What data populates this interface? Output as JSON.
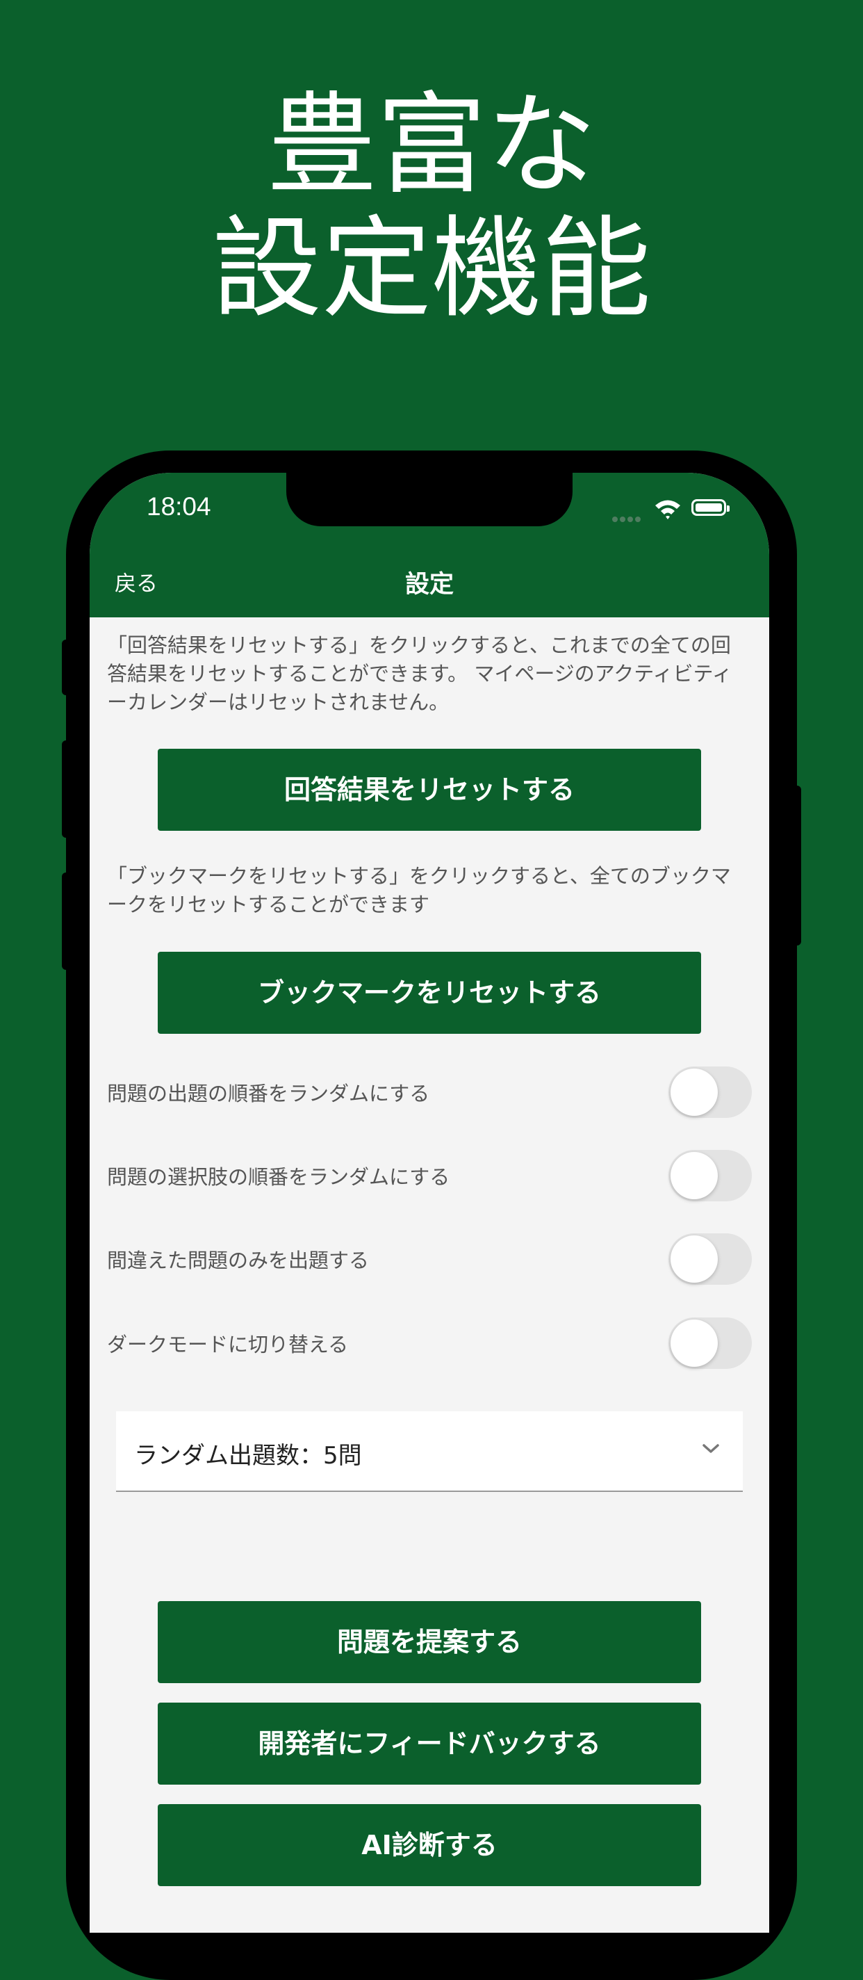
{
  "promo": {
    "line1": "豊富な",
    "line2": "設定機能"
  },
  "status_bar": {
    "time": "18:04"
  },
  "nav": {
    "back_label": "戻る",
    "title": "設定"
  },
  "reset_results": {
    "description": "「回答結果をリセットする」をクリックすると、これまでの全ての回答結果をリセットすることができます。 マイページのアクティビティーカレンダーはリセットされません。",
    "button_label": "回答結果をリセットする"
  },
  "reset_bookmarks": {
    "description": "「ブックマークをリセットする」をクリックすると、全てのブックマークをリセットすることができます",
    "button_label": "ブックマークをリセットする"
  },
  "toggles": [
    {
      "label": "問題の出題の順番をランダムにする",
      "on": false
    },
    {
      "label": "問題の選択肢の順番をランダムにする",
      "on": false
    },
    {
      "label": "間違えた問題のみを出題する",
      "on": false
    },
    {
      "label": "ダークモードに切り替える",
      "on": false
    }
  ],
  "random_count_select": {
    "value": "ランダム出題数：5問"
  },
  "actions": {
    "suggest_label": "問題を提案する",
    "feedback_label": "開発者にフィードバックする",
    "ai_label": "AI診断する"
  },
  "colors": {
    "brand_green": "#0b602c",
    "screen_bg": "#f4f4f4",
    "toggle_off": "#e3e3e3"
  },
  "icons": [
    "wifi-icon",
    "battery-icon",
    "chevron-down-icon"
  ]
}
